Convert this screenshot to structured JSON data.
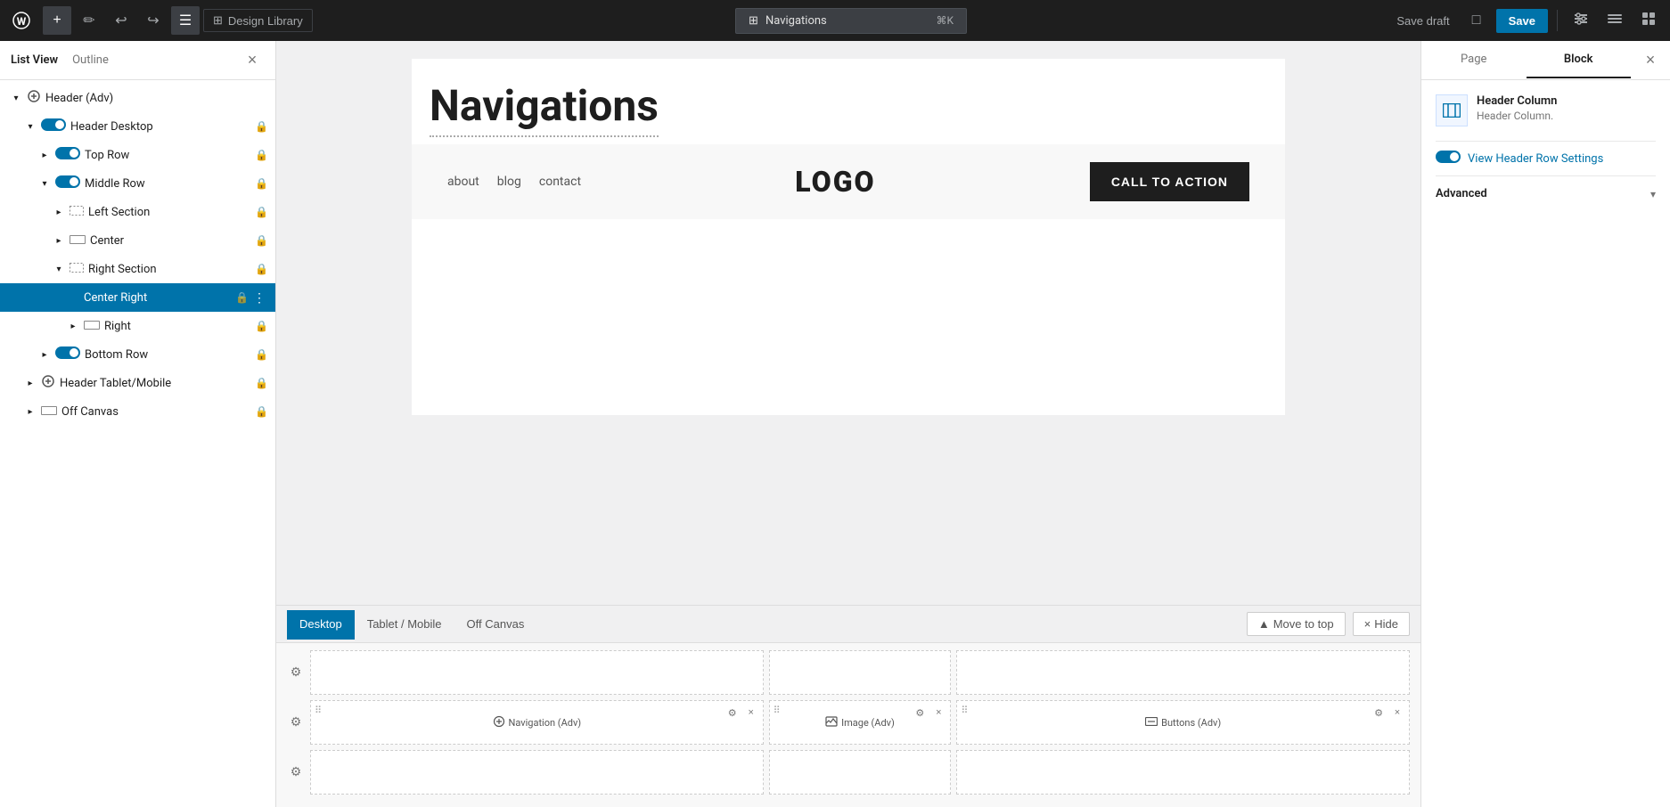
{
  "toolbar": {
    "wp_icon": "W",
    "add_label": "+",
    "edit_icon": "✏",
    "undo_icon": "↩",
    "redo_icon": "↪",
    "list_view_icon": "☰",
    "design_library_label": "Design Library",
    "nav_title": "Navigations",
    "nav_shortcut": "⌘K",
    "save_draft_label": "Save draft",
    "save_label": "Save",
    "preview_icon": "□",
    "settings_icon": "⚙",
    "tools_icon": "🔧",
    "blocks_icon": "▦",
    "options_icon": "⋮"
  },
  "sidebar": {
    "list_view_label": "List View",
    "outline_label": "Outline",
    "close_label": "×",
    "items": [
      {
        "id": "header-adv",
        "label": "Header (Adv)",
        "indent": 0,
        "toggle": "open",
        "has_toggle": true,
        "selected": false,
        "icon": "edit"
      },
      {
        "id": "header-desktop",
        "label": "Header Desktop",
        "indent": 1,
        "toggle": "open",
        "has_toggle": true,
        "selected": false,
        "icon": "row"
      },
      {
        "id": "top-row",
        "label": "Top Row",
        "indent": 2,
        "toggle": "closed",
        "has_toggle": true,
        "selected": false,
        "icon": "toggle"
      },
      {
        "id": "middle-row",
        "label": "Middle Row",
        "indent": 2,
        "toggle": "open",
        "has_toggle": true,
        "selected": false,
        "icon": "toggle"
      },
      {
        "id": "left-section",
        "label": "Left Section",
        "indent": 3,
        "toggle": "closed",
        "has_toggle": true,
        "selected": false,
        "icon": "nav"
      },
      {
        "id": "center",
        "label": "Center",
        "indent": 3,
        "toggle": "closed",
        "has_toggle": true,
        "selected": false,
        "icon": "row"
      },
      {
        "id": "right-section",
        "label": "Right Section",
        "indent": 3,
        "toggle": "open",
        "has_toggle": true,
        "selected": false,
        "icon": "nav"
      },
      {
        "id": "center-right",
        "label": "Center Right",
        "indent": 4,
        "toggle": "none",
        "has_toggle": false,
        "selected": true,
        "icon": "none"
      },
      {
        "id": "right",
        "label": "Right",
        "indent": 4,
        "toggle": "closed",
        "has_toggle": true,
        "selected": false,
        "icon": "row"
      },
      {
        "id": "bottom-row",
        "label": "Bottom Row",
        "indent": 2,
        "toggle": "closed",
        "has_toggle": true,
        "selected": false,
        "icon": "toggle"
      },
      {
        "id": "header-tablet-mobile",
        "label": "Header Tablet/Mobile",
        "indent": 1,
        "toggle": "closed",
        "has_toggle": true,
        "selected": false,
        "icon": "edit"
      },
      {
        "id": "off-canvas",
        "label": "Off Canvas",
        "indent": 1,
        "toggle": "closed",
        "has_toggle": true,
        "selected": false,
        "icon": "row"
      }
    ]
  },
  "editor": {
    "page_title": "Navigations",
    "nav_links": [
      "about",
      "blog",
      "contact"
    ],
    "logo_text": "LOGO",
    "cta_label": "CALL TO ACTION"
  },
  "bottom_panel": {
    "tabs": [
      {
        "id": "desktop",
        "label": "Desktop",
        "active": true
      },
      {
        "id": "tablet-mobile",
        "label": "Tablet / Mobile",
        "active": false
      },
      {
        "id": "off-canvas",
        "label": "Off Canvas",
        "active": false
      }
    ],
    "move_to_top_label": "Move to top",
    "hide_label": "Hide",
    "rows": [
      {
        "id": "row-1",
        "cells": [
          {
            "id": "cell-1-1",
            "wide": true,
            "content": null
          },
          {
            "id": "cell-1-2",
            "narrow": true,
            "content": null
          },
          {
            "id": "cell-1-3",
            "wide": true,
            "content": null
          }
        ]
      },
      {
        "id": "row-2",
        "cells": [
          {
            "id": "cell-2-1",
            "wide": true,
            "content": {
              "label": "Navigation (Adv)",
              "icon": "nav"
            }
          },
          {
            "id": "cell-2-2",
            "narrow": true,
            "content": {
              "label": "Image (Adv)",
              "icon": "img"
            }
          },
          {
            "id": "cell-2-3",
            "wide": true,
            "content": {
              "label": "Buttons (Adv)",
              "icon": "btn"
            }
          }
        ]
      },
      {
        "id": "row-3",
        "cells": [
          {
            "id": "cell-3-1",
            "wide": true,
            "content": null
          },
          {
            "id": "cell-3-2",
            "narrow": true,
            "content": null
          },
          {
            "id": "cell-3-3",
            "wide": true,
            "content": null
          }
        ]
      }
    ]
  },
  "right_panel": {
    "page_tab": "Page",
    "block_tab": "Block",
    "close_label": "×",
    "block_name": "Header Column",
    "block_desc": "Header Column.",
    "view_settings_label": "View Header Row Settings",
    "advanced_label": "Advanced"
  }
}
